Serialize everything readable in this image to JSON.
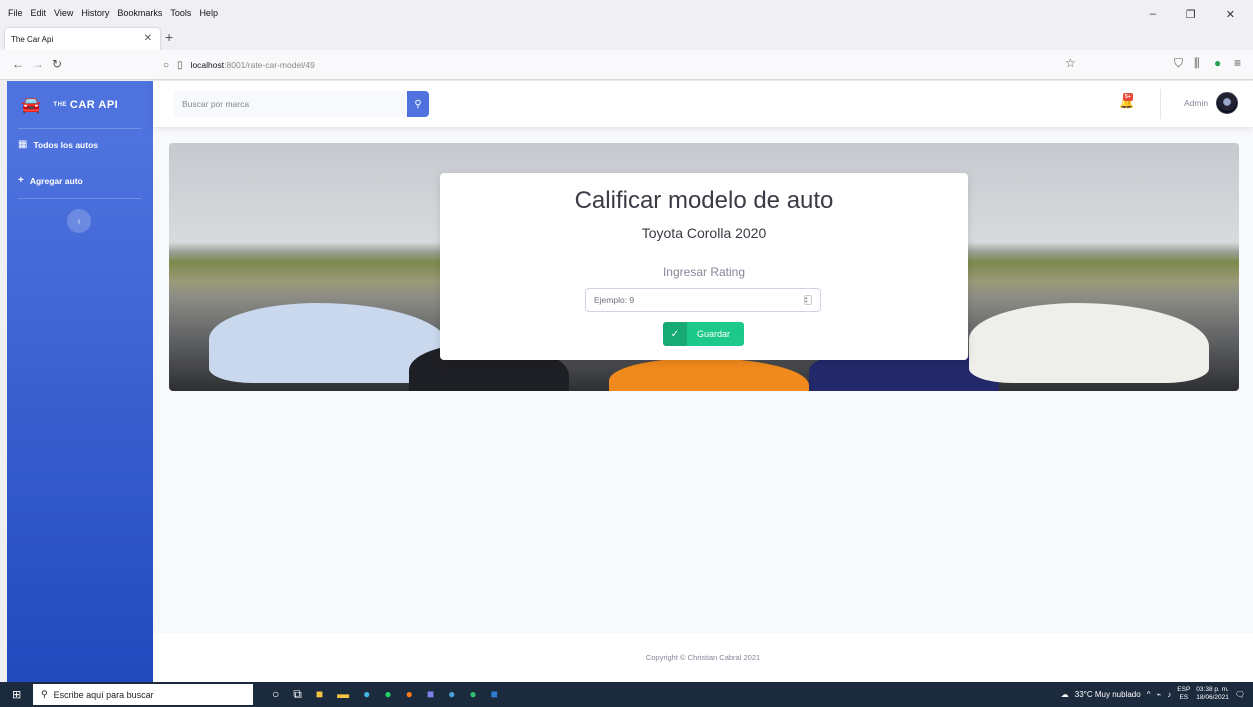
{
  "browser": {
    "menu": [
      "File",
      "Edit",
      "View",
      "History",
      "Bookmarks",
      "Tools",
      "Help"
    ],
    "tab_title": "The Car Api",
    "url_host": "localhost",
    "url_path": ":8001/rate-car-model/49"
  },
  "sidebar": {
    "brand_sup": "THE",
    "brand_text": "CAR API",
    "items": [
      {
        "label": "Todos los autos",
        "icon": "table-icon"
      },
      {
        "label": "Agregar auto",
        "icon": "plus-icon"
      }
    ]
  },
  "topbar": {
    "search_placeholder": "Buscar por marca",
    "alert_badge": "5+",
    "user_name": "Admin"
  },
  "card": {
    "title": "Calificar modelo de auto",
    "subtitle": "Toyota Corolla 2020",
    "rating_label": "Ingresar Rating",
    "rating_placeholder": "Ejemplo: 9",
    "save_label": "Guardar"
  },
  "footer": {
    "copyright": "Copyright © Christian Cabral 2021"
  },
  "taskbar": {
    "search_placeholder": "Escribe aquí para buscar",
    "weather": "33°C Muy nublado",
    "lang_top": "ESP",
    "lang_bottom": "ES",
    "time": "03:38 p. m.",
    "date": "18/06/2021"
  },
  "colors": {
    "sidebar_top": "#4e73df",
    "sidebar_bottom": "#224abe",
    "save_button": "#1cc88a"
  }
}
